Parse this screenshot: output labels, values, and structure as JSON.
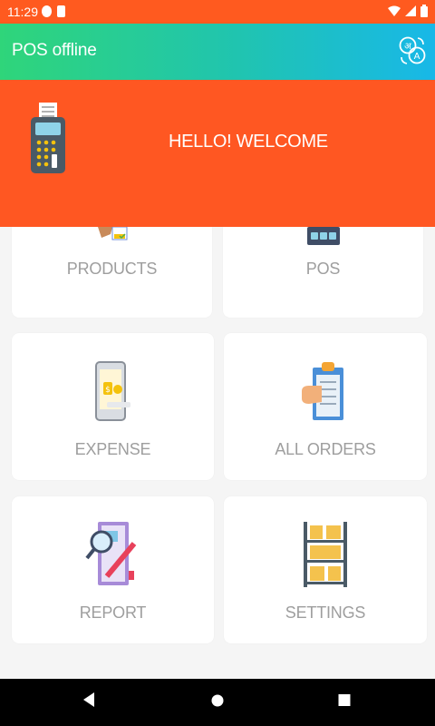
{
  "status_bar": {
    "time": "11:29",
    "icons": [
      "notification-icon",
      "sim-icon",
      "wifi-icon",
      "signal-icon",
      "battery-icon"
    ]
  },
  "app_bar": {
    "title": "POS offline",
    "action_icon": "translate-icon"
  },
  "hero": {
    "greeting": "HELLO! WELCOME",
    "image": "pos-terminal-icon"
  },
  "menu": {
    "items": [
      {
        "label": "PRODUCTS",
        "icon": "products-icon"
      },
      {
        "label": "POS",
        "icon": "pos-register-icon"
      },
      {
        "label": "EXPENSE",
        "icon": "expense-phone-icon"
      },
      {
        "label": "ALL ORDERS",
        "icon": "orders-clipboard-icon"
      },
      {
        "label": "REPORT",
        "icon": "report-magnifier-icon"
      },
      {
        "label": "SETTINGS",
        "icon": "shelf-icon"
      }
    ]
  },
  "nav_bar": {
    "buttons": [
      "back-icon",
      "home-icon",
      "recents-icon"
    ]
  },
  "colors": {
    "status_bar": "#ff5a1f",
    "app_bar_start": "#2fd57a",
    "app_bar_end": "#18b8e8",
    "hero": "#ff5722",
    "card_label": "#9e9e9e"
  }
}
